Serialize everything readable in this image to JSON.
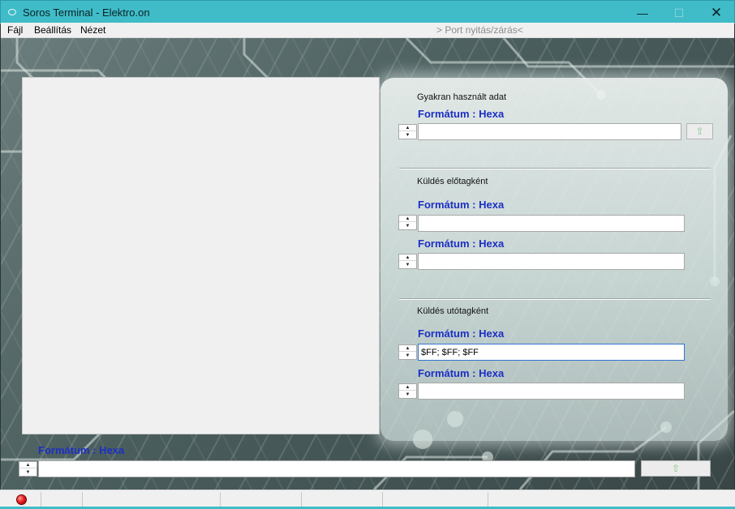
{
  "window": {
    "title": "Soros Terminal - Elektro.on",
    "minimize_glyph": "—",
    "maximize_glyph": "☐",
    "close_glyph": "✕"
  },
  "menu": {
    "items": [
      "Fájl",
      "Beállítás",
      "Nézet"
    ],
    "port_status": "> Port nyitás/zárás<"
  },
  "panel": {
    "frequent": {
      "label": "Gyakran használt adat",
      "format": "Formátum : Hexa",
      "value": "",
      "send_icon": "send-arrow-icon"
    },
    "prefix": {
      "label": "Küldés előtagként",
      "format_1": "Formátum : Hexa",
      "value_1": "",
      "format_2": "Formátum : Hexa",
      "value_2": ""
    },
    "suffix": {
      "label": "Küldés utótagként",
      "format_1": "Formátum : Hexa",
      "value_1": "$FF; $FF; $FF",
      "format_2": "Formátum : Hexa",
      "value_2": ""
    }
  },
  "bottom": {
    "format": "Formátum : Hexa",
    "value": "",
    "send_icon": "send-arrow-icon"
  },
  "statusbar": {
    "led_state": "disconnected",
    "led_color": "#e42020"
  },
  "colors": {
    "titlebar": "#3fbcc8",
    "format_label": "#1c2fc4"
  }
}
